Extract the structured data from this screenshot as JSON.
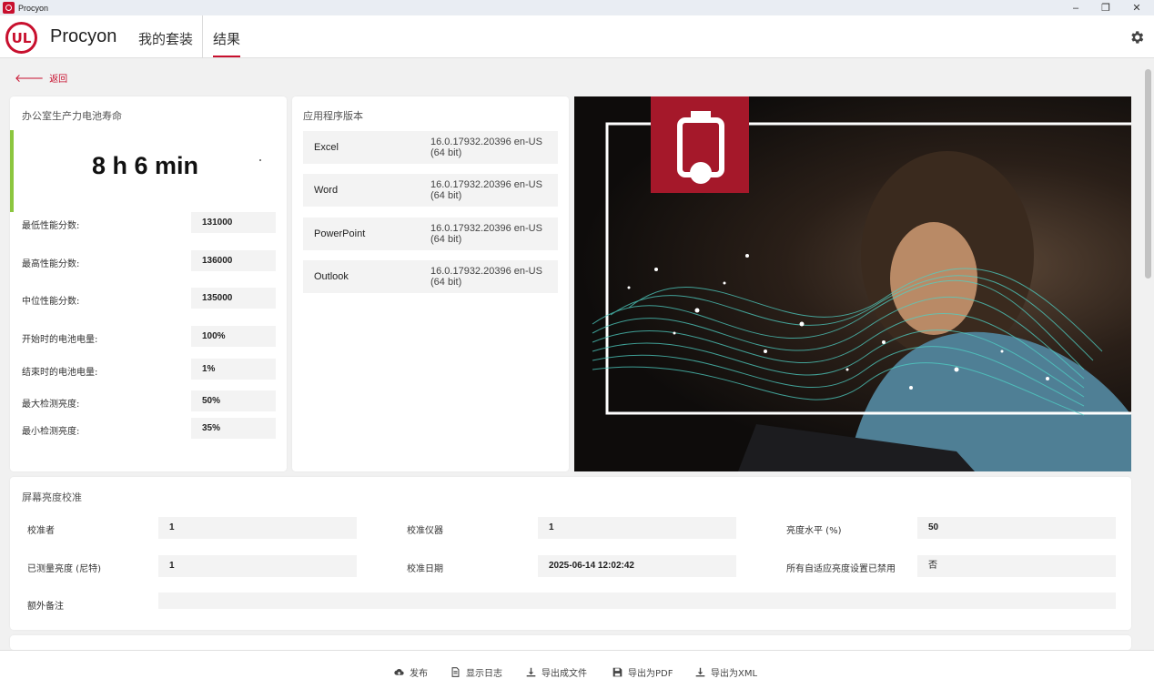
{
  "window": {
    "title": "Procyon",
    "minimize": "–",
    "maximize": "❐",
    "close": "✕"
  },
  "header": {
    "logo_text": "UL",
    "brand": "Procyon",
    "nav": [
      {
        "label": "我的套装"
      },
      {
        "label": "结果"
      }
    ]
  },
  "back_label": "返回",
  "battery_card": {
    "title": "办公室生产力电池寿命",
    "score": "8 h 6 min",
    "stats": [
      {
        "label": "最低性能分数:",
        "value": "131000"
      },
      {
        "label": "最高性能分数:",
        "value": "136000"
      },
      {
        "label": "中位性能分数:",
        "value": "135000"
      },
      {
        "label": "开始时的电池电量:",
        "value": "100%"
      },
      {
        "label": "结束时的电池电量:",
        "value": "1%"
      },
      {
        "label": "最大检测亮度:",
        "value": "50%"
      },
      {
        "label": "最小检测亮度:",
        "value": "35%"
      }
    ]
  },
  "apps_card": {
    "title": "应用程序版本",
    "apps": [
      {
        "name": "Excel",
        "version": "16.0.17932.20396 en-US (64 bit)"
      },
      {
        "name": "Word",
        "version": "16.0.17932.20396 en-US (64 bit)"
      },
      {
        "name": "PowerPoint",
        "version": "16.0.17932.20396 en-US (64 bit)"
      },
      {
        "name": "Outlook",
        "version": "16.0.17932.20396 en-US (64 bit)"
      }
    ]
  },
  "calibration": {
    "title": "屏幕亮度校准",
    "calibrator_label": "校准者",
    "calibrator_value": "1",
    "instrument_label": "校准仪器",
    "instrument_value": "1",
    "brightness_label": "亮度水平 (%)",
    "brightness_value": "50",
    "measured_label": "已测量亮度 (尼特)",
    "measured_value": "1",
    "date_label": "校准日期",
    "date_value": "2025-06-14 12:02:42",
    "adaptive_label": "所有自适应亮度设置已禁用",
    "adaptive_value": "否",
    "notes_label": "额外备注",
    "notes_value": ""
  },
  "footer": {
    "publish": "发布",
    "show_log": "显示日志",
    "export_file": "导出成文件",
    "export_pdf": "导出为PDF",
    "export_xml": "导出为XML"
  },
  "colors": {
    "accent": "#c8102e",
    "score_bar": "#8cc63f"
  },
  "icons": {
    "settings": "gear-icon",
    "back": "arrow-left-icon",
    "hero_badge": "battery-icon"
  }
}
